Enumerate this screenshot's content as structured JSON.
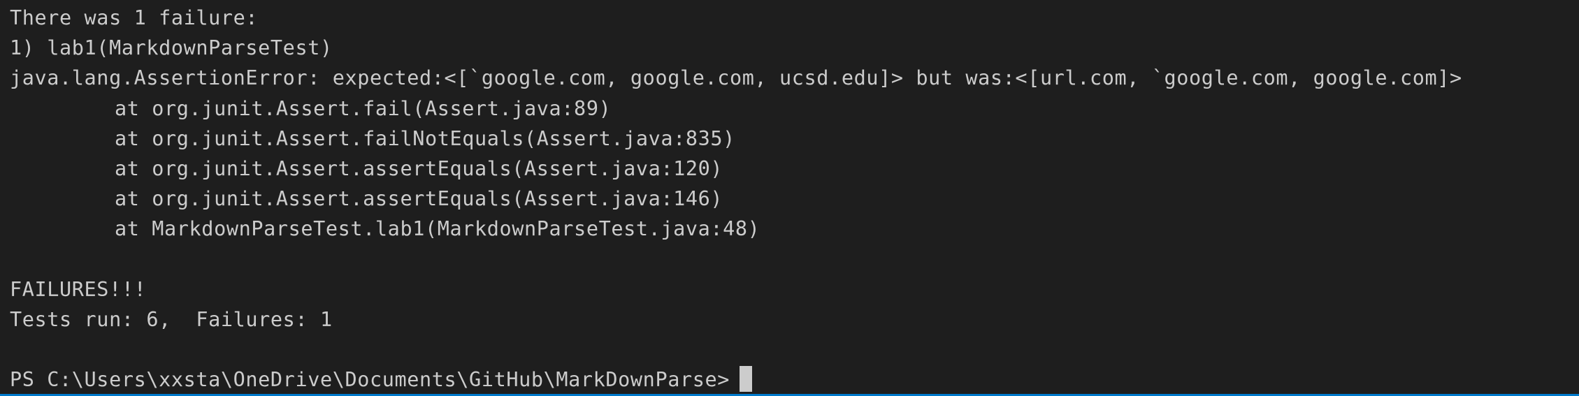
{
  "terminal": {
    "summary": "There was 1 failure:",
    "failure_title": "1) lab1(MarkdownParseTest)",
    "error_message": "java.lang.AssertionError: expected:<[`google.com, google.com, ucsd.edu]> but was:<[url.com, `google.com, google.com]>",
    "stack_trace": [
      "at org.junit.Assert.fail(Assert.java:89)",
      "at org.junit.Assert.failNotEquals(Assert.java:835)",
      "at org.junit.Assert.assertEquals(Assert.java:120)",
      "at org.junit.Assert.assertEquals(Assert.java:146)",
      "at MarkdownParseTest.lab1(MarkdownParseTest.java:48)"
    ],
    "failures_banner": "FAILURES!!!",
    "tests_result": "Tests run: 6,  Failures: 1",
    "prompt": "PS C:\\Users\\xxsta\\OneDrive\\Documents\\GitHub\\MarkDownParse>"
  },
  "colors": {
    "background": "#1e1e1e",
    "foreground": "#cccccc",
    "cursor": "#cccccc",
    "accent": "#007acc"
  }
}
